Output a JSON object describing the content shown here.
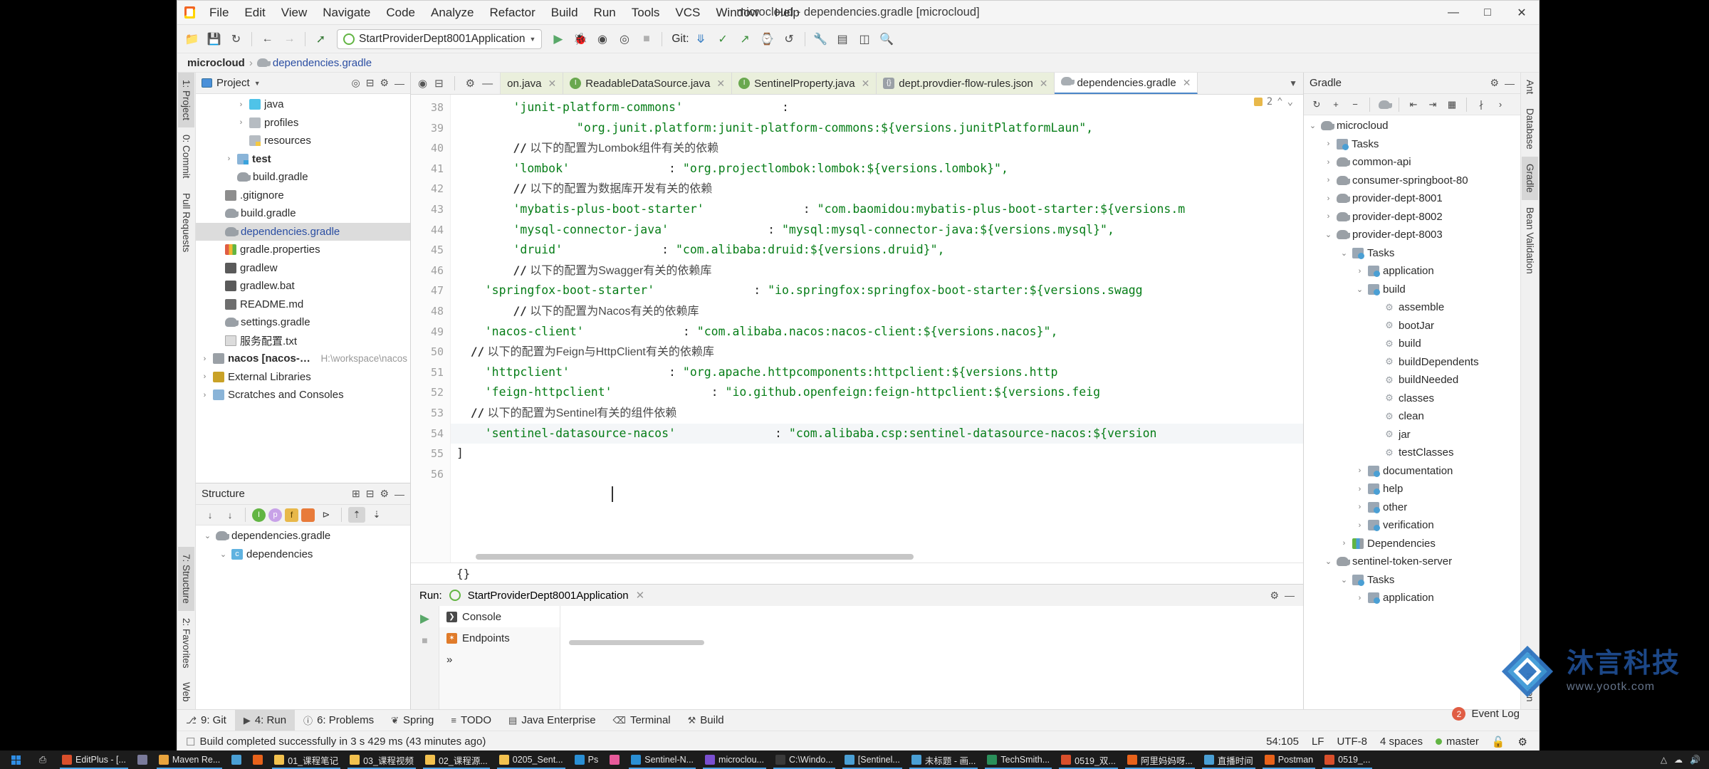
{
  "window": {
    "title": "microcloud - dependencies.gradle [microcloud]",
    "app_icon": "intellij-icon",
    "minimize": "—",
    "maximize": "☐",
    "close": "✕"
  },
  "menu": [
    "File",
    "Edit",
    "View",
    "Navigate",
    "Code",
    "Analyze",
    "Refactor",
    "Build",
    "Run",
    "Tools",
    "VCS",
    "Window",
    "Help"
  ],
  "toolbar": {
    "open_icon": "open-folder-icon",
    "save_icon": "save-icon",
    "sync_icon": "sync-icon",
    "back_icon": "back-arrow-icon",
    "forward_icon": "forward-arrow-icon",
    "compile_icon": "compile-hammer-icon",
    "run_config": "StartProviderDept8001Application",
    "run_icon": "run-icon",
    "debug_icon": "debug-icon",
    "run_with_coverage_icon": "coverage-icon",
    "profile_icon": "profiler-icon",
    "stop_icon": "stop-icon",
    "git_label": "Git:",
    "git_update_icon": "git-update-icon",
    "git_commit_icon": "git-commit-icon",
    "git_push_icon": "git-push-icon",
    "git_history_icon": "git-history-icon",
    "git_revert_icon": "git-revert-icon",
    "settings_icon": "gear-icon",
    "structure_icon": "structure-icon",
    "layout_icon": "layout-icon",
    "search_icon": "search-icon"
  },
  "breadcrumb": {
    "root": "microcloud",
    "separator": "›",
    "file": "dependencies.gradle"
  },
  "left_rail": [
    {
      "label": "1: Project",
      "active": true
    },
    {
      "label": "0: Commit",
      "active": false
    },
    {
      "label": "Pull Requests",
      "active": false
    },
    {
      "label": "7: Structure",
      "active": true
    },
    {
      "label": "2: Favorites",
      "active": false
    },
    {
      "label": "Web",
      "active": false
    }
  ],
  "right_rail": [
    {
      "label": "Ant",
      "active": false
    },
    {
      "label": "Database",
      "active": false
    },
    {
      "label": "Gradle",
      "active": true
    },
    {
      "label": "Bean Validation",
      "active": false
    },
    {
      "label": "m",
      "active": false
    },
    {
      "label": "Maven",
      "active": false
    }
  ],
  "project_panel": {
    "title": "Project",
    "icon": "project-view-icon",
    "collapse_icon": "collapse-all-icon",
    "settings_icon": "gear-icon",
    "hide_icon": "hide-icon",
    "tree": [
      {
        "indent": 3,
        "arrow": "›",
        "icon": "folder-java",
        "label": "java",
        "path": ""
      },
      {
        "indent": 3,
        "arrow": "›",
        "icon": "folder-gray",
        "label": "profiles",
        "path": ""
      },
      {
        "indent": 3,
        "arrow": "",
        "icon": "folder-res",
        "label": "resources",
        "path": ""
      },
      {
        "indent": 2,
        "arrow": "›",
        "icon": "folder-test",
        "label": "test",
        "path": "",
        "bold": true
      },
      {
        "indent": 2,
        "arrow": "",
        "icon": "gradle-file",
        "label": "build.gradle",
        "path": ""
      },
      {
        "indent": 1,
        "arrow": "",
        "icon": "git-file",
        "label": ".gitignore",
        "path": ""
      },
      {
        "indent": 1,
        "arrow": "",
        "icon": "gradle-file",
        "label": "build.gradle",
        "path": ""
      },
      {
        "indent": 1,
        "arrow": "",
        "icon": "gradle-file",
        "label": "dependencies.gradle",
        "path": "",
        "selected": true
      },
      {
        "indent": 1,
        "arrow": "",
        "icon": "props-file",
        "label": "gradle.properties",
        "path": ""
      },
      {
        "indent": 1,
        "arrow": "",
        "icon": "bat-file",
        "label": "gradlew",
        "path": ""
      },
      {
        "indent": 1,
        "arrow": "",
        "icon": "bat-file",
        "label": "gradlew.bat",
        "path": ""
      },
      {
        "indent": 1,
        "arrow": "",
        "icon": "md-file",
        "label": "README.md",
        "path": ""
      },
      {
        "indent": 1,
        "arrow": "",
        "icon": "gradle-file",
        "label": "settings.gradle",
        "path": ""
      },
      {
        "indent": 1,
        "arrow": "",
        "icon": "txt-file",
        "label": "服务配置.txt",
        "path": ""
      },
      {
        "indent": 0,
        "arrow": "›",
        "icon": "nacos-module",
        "label": "nacos [nacos-all]",
        "path": "H:\\workspace\\nacos",
        "bold": true
      },
      {
        "indent": 0,
        "arrow": "›",
        "icon": "lib-icon",
        "label": "External Libraries",
        "path": ""
      },
      {
        "indent": 0,
        "arrow": "›",
        "icon": "scratch-icon",
        "label": "Scratches and Consoles",
        "path": ""
      }
    ]
  },
  "structure_panel": {
    "title": "Structure",
    "expand_icon": "expand-all-icon",
    "collapse_icon": "collapse-all-icon",
    "settings_icon": "gear-icon",
    "hide_icon": "hide-icon",
    "toolbar_icons": [
      "sort-by-visibility-icon",
      "sort-alphabetically-icon",
      "show-inherited-icon",
      "show-properties-icon",
      "show-fields-icon",
      "show-non-public-icon",
      "show-anonymous-icon",
      "scroll-from-source-icon",
      "scroll-to-source-icon"
    ],
    "tree": [
      {
        "indent": 0,
        "arrow": "⌄",
        "icon": "gradle-file",
        "label": "dependencies.gradle"
      },
      {
        "indent": 1,
        "arrow": "⌄",
        "icon": "class-icon",
        "label": "dependencies"
      }
    ]
  },
  "editor": {
    "tool_icons": [
      "locate-icon",
      "collapse-icon",
      "gear-icon",
      "hide-icon"
    ],
    "tabs": [
      {
        "label": "on.java",
        "icon": "java-class-icon",
        "active": false,
        "truncated": true
      },
      {
        "label": "ReadableDataSource.java",
        "icon": "java-class-icon",
        "active": false
      },
      {
        "label": "SentinelProperty.java",
        "icon": "java-class-icon",
        "active": false
      },
      {
        "label": "dept.provdier-flow-rules.json",
        "icon": "json-file-icon",
        "active": false
      },
      {
        "label": "dependencies.gradle",
        "icon": "gradle-file-icon",
        "active": true
      }
    ],
    "overflow_icon": "chevron-down-icon",
    "warning_count": "2",
    "warning_icon": "warning-icon",
    "up_icon": "chevron-up-icon",
    "down_icon": "chevron-down-icon",
    "closing_brace": "{}",
    "lines": [
      {
        "num": "38",
        "indent": 8,
        "key": "'junit-platform-commons'",
        "colon": ":",
        "value": ""
      },
      {
        "num": "39",
        "indent": 16,
        "key": "",
        "colon": "",
        "value": "\"org.junit.platform:junit-platform-commons:${versions.junitPlatformLaun",
        "tail": "\","
      },
      {
        "num": "40",
        "comment": "// 以下的配置为Lombok组件有关的依赖",
        "indent": 8
      },
      {
        "num": "41",
        "indent": 8,
        "key": "'lombok'",
        "colon": ":",
        "value": "\"org.projectlombok:lombok:${versions.lombok}\","
      },
      {
        "num": "42",
        "comment": "// 以下的配置为数据库开发有关的依赖",
        "indent": 8
      },
      {
        "num": "43",
        "indent": 8,
        "key": "'mybatis-plus-boot-starter'",
        "colon": ":",
        "value": "\"com.baomidou:mybatis-plus-boot-starter:${versions.m"
      },
      {
        "num": "44",
        "indent": 8,
        "key": "'mysql-connector-java'",
        "colon": ":",
        "value": "\"mysql:mysql-connector-java:${versions.mysql}\","
      },
      {
        "num": "45",
        "indent": 8,
        "key": "'druid'",
        "colon": ":",
        "value": "\"com.alibaba:druid:${versions.druid}\","
      },
      {
        "num": "46",
        "comment": "// 以下的配置为Swagger有关的依赖库",
        "indent": 8
      },
      {
        "num": "47",
        "indent": 4,
        "key": "'springfox-boot-starter'",
        "colon": ":",
        "value": "\"io.springfox:springfox-boot-starter:${versions.swagg"
      },
      {
        "num": "48",
        "comment": "// 以下的配置为Nacos有关的依赖库",
        "indent": 8
      },
      {
        "num": "49",
        "indent": 4,
        "key": "'nacos-client'",
        "colon": ":",
        "value": "\"com.alibaba.nacos:nacos-client:${versions.nacos}\","
      },
      {
        "num": "50",
        "comment": "// 以下的配置为Feign与HttpClient有关的依赖库",
        "indent": 2
      },
      {
        "num": "51",
        "indent": 4,
        "key": "'httpclient'",
        "colon": ":",
        "value": "\"org.apache.httpcomponents:httpclient:${versions.http"
      },
      {
        "num": "52",
        "indent": 4,
        "key": "'feign-httpclient'",
        "colon": ":",
        "value": "\"io.github.openfeign:feign-httpclient:${versions.feig"
      },
      {
        "num": "53",
        "comment": "// 以下的配置为Sentinel有关的组件依赖",
        "indent": 2
      },
      {
        "num": "54",
        "indent": 4,
        "key": "'sentinel-datasource-nacos'",
        "colon": ":",
        "value": "\"com.alibaba.csp:sentinel-datasource-nacos:${version",
        "highlight": true
      },
      {
        "num": "55",
        "indent": 0,
        "key": "]",
        "colon": "",
        "value": ""
      },
      {
        "num": "56",
        "indent": 0,
        "key": "",
        "colon": "",
        "value": ""
      }
    ]
  },
  "run_panel": {
    "label": "Run:",
    "config_name": "StartProviderDept8001Application",
    "close_icon": "close-icon",
    "rerun_icon": "rerun-icon",
    "stop_icon": "stop-icon",
    "settings_icon": "gear-icon",
    "hide_icon": "hide-icon",
    "tabs": [
      {
        "label": "Console",
        "icon": "console-icon",
        "active": true
      },
      {
        "label": "Endpoints",
        "icon": "endpoints-icon",
        "active": false
      }
    ],
    "expand_icon": "chevron-right-icon"
  },
  "gradle_panel": {
    "title": "Gradle",
    "settings_icon": "gear-icon",
    "hide_icon": "hide-icon",
    "toolbar_icons": [
      "refresh-icon",
      "add-icon",
      "remove-icon",
      "gradle-elephant-icon",
      "expand-all-icon",
      "collapse-all-icon",
      "task-group-icon",
      "toggle-offline-icon",
      "more-icon"
    ],
    "tree": [
      {
        "indent": 0,
        "arrow": "⌄",
        "icon": "gradle-elephant",
        "label": "microcloud"
      },
      {
        "indent": 1,
        "arrow": "›",
        "icon": "tasks-folder",
        "label": "Tasks"
      },
      {
        "indent": 1,
        "arrow": "›",
        "icon": "gradle-elephant",
        "label": "common-api"
      },
      {
        "indent": 1,
        "arrow": "›",
        "icon": "gradle-elephant",
        "label": "consumer-springboot-80"
      },
      {
        "indent": 1,
        "arrow": "›",
        "icon": "gradle-elephant",
        "label": "provider-dept-8001"
      },
      {
        "indent": 1,
        "arrow": "›",
        "icon": "gradle-elephant",
        "label": "provider-dept-8002"
      },
      {
        "indent": 1,
        "arrow": "⌄",
        "icon": "gradle-elephant",
        "label": "provider-dept-8003"
      },
      {
        "indent": 2,
        "arrow": "⌄",
        "icon": "tasks-folder",
        "label": "Tasks"
      },
      {
        "indent": 3,
        "arrow": "›",
        "icon": "tasks-folder",
        "label": "application"
      },
      {
        "indent": 3,
        "arrow": "⌄",
        "icon": "tasks-folder",
        "label": "build"
      },
      {
        "indent": 4,
        "arrow": "",
        "icon": "gear-task",
        "label": "assemble"
      },
      {
        "indent": 4,
        "arrow": "",
        "icon": "gear-task",
        "label": "bootJar"
      },
      {
        "indent": 4,
        "arrow": "",
        "icon": "gear-task",
        "label": "build"
      },
      {
        "indent": 4,
        "arrow": "",
        "icon": "gear-task",
        "label": "buildDependents"
      },
      {
        "indent": 4,
        "arrow": "",
        "icon": "gear-task",
        "label": "buildNeeded"
      },
      {
        "indent": 4,
        "arrow": "",
        "icon": "gear-task",
        "label": "classes"
      },
      {
        "indent": 4,
        "arrow": "",
        "icon": "gear-task",
        "label": "clean"
      },
      {
        "indent": 4,
        "arrow": "",
        "icon": "gear-task",
        "label": "jar"
      },
      {
        "indent": 4,
        "arrow": "",
        "icon": "gear-task",
        "label": "testClasses"
      },
      {
        "indent": 3,
        "arrow": "›",
        "icon": "tasks-folder",
        "label": "documentation"
      },
      {
        "indent": 3,
        "arrow": "›",
        "icon": "tasks-folder",
        "label": "help"
      },
      {
        "indent": 3,
        "arrow": "›",
        "icon": "tasks-folder",
        "label": "other"
      },
      {
        "indent": 3,
        "arrow": "›",
        "icon": "tasks-folder",
        "label": "verification"
      },
      {
        "indent": 2,
        "arrow": "›",
        "icon": "deps-icon",
        "label": "Dependencies"
      },
      {
        "indent": 1,
        "arrow": "⌄",
        "icon": "gradle-elephant",
        "label": "sentinel-token-server"
      },
      {
        "indent": 2,
        "arrow": "⌄",
        "icon": "tasks-folder",
        "label": "Tasks"
      },
      {
        "indent": 3,
        "arrow": "›",
        "icon": "tasks-folder",
        "label": "application"
      }
    ]
  },
  "status_tabs": [
    {
      "label": "9: Git",
      "icon": "git-icon",
      "active": false
    },
    {
      "label": "4: Run",
      "icon": "run-icon",
      "active": true
    },
    {
      "label": "6: Problems",
      "icon": "problems-icon",
      "active": false
    },
    {
      "label": "Spring",
      "icon": "spring-icon",
      "active": false
    },
    {
      "label": "TODO",
      "icon": "todo-icon",
      "active": false
    },
    {
      "label": "Java Enterprise",
      "icon": "java-enterprise-icon",
      "active": false
    },
    {
      "label": "Terminal",
      "icon": "terminal-icon",
      "active": false
    },
    {
      "label": "Build",
      "icon": "build-icon",
      "active": false
    }
  ],
  "event_log": {
    "badge": "2",
    "label": "Event Log"
  },
  "status_bar": {
    "message": "Build completed successfully in 3 s 429 ms (43 minutes ago)",
    "message_icon": "build-status-icon",
    "caret": "54:105",
    "line_separator": "LF",
    "encoding": "UTF-8",
    "indent": "4 spaces",
    "branch": "master",
    "branch_icon": "git-branch-icon",
    "lock_icon": "unlocked-icon",
    "inspection_icon": "inspections-icon"
  },
  "watermark": {
    "cn": "沐言科技",
    "url": "www.yootk.com"
  },
  "taskbar": {
    "start_icon": "windows-start-icon",
    "task_view_icon": "task-view-icon",
    "items": [
      {
        "label": "EditPlus - [...",
        "color": "#d94f2b",
        "active": true
      },
      {
        "label": "",
        "color": "#7a7a9a",
        "active": false
      },
      {
        "label": "Maven Re...",
        "color": "#e8a33d",
        "active": true
      },
      {
        "label": "",
        "color": "#4a9fd4",
        "active": false
      },
      {
        "label": "",
        "color": "#e8621a",
        "active": false
      },
      {
        "label": "01_课程笔记",
        "color": "#f2c14e",
        "active": true
      },
      {
        "label": "03_课程视频",
        "color": "#f2c14e",
        "active": true
      },
      {
        "label": "02_课程源...",
        "color": "#f2c14e",
        "active": true
      },
      {
        "label": "0205_Sent...",
        "color": "#f2c14e",
        "active": true
      },
      {
        "label": "Ps",
        "color": "#2a8fd4",
        "active": false
      },
      {
        "label": "",
        "color": "#e85a9a",
        "active": false
      },
      {
        "label": "Sentinel-N...",
        "color": "#2a8fd4",
        "active": true
      },
      {
        "label": "microclou...",
        "color": "#7a4fd0",
        "active": true
      },
      {
        "label": "C:\\Windo...",
        "color": "#3a3a3a",
        "active": true
      },
      {
        "label": "[Sentinel...",
        "color": "#4a9fd4",
        "active": true
      },
      {
        "label": "未标题 - 画...",
        "color": "#4a9fd4",
        "active": true
      },
      {
        "label": "TechSmith...",
        "color": "#2a8f5a",
        "active": true
      },
      {
        "label": "0519_双...",
        "color": "#d94f2b",
        "active": true
      },
      {
        "label": "阿里妈妈呀...",
        "color": "#e8621a",
        "active": true
      },
      {
        "label": "直播时间",
        "color": "#4a9fd4",
        "active": true
      },
      {
        "label": "Postman",
        "color": "#e8621a",
        "active": true
      },
      {
        "label": "0519_...",
        "color": "#d94f2b",
        "active": true
      }
    ]
  }
}
